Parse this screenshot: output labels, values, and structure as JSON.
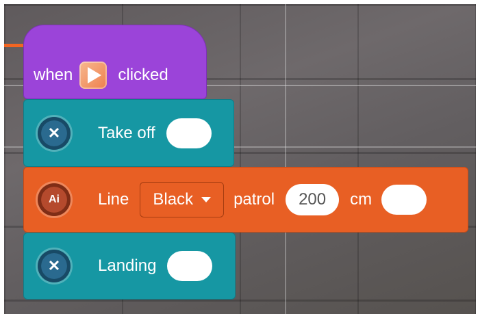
{
  "hat": {
    "prefix": "when",
    "suffix": "clicked",
    "icon": "play-icon"
  },
  "blocks": [
    {
      "label": "Take off",
      "icon": "drone-icon"
    },
    {
      "label": "Line",
      "icon": "ai-icon",
      "icon_text": "Ai",
      "dropdown": "Black",
      "action": "patrol",
      "value": "200",
      "unit": "cm"
    },
    {
      "label": "Landing",
      "icon": "drone-icon"
    }
  ],
  "colors": {
    "event": "#9b44d9",
    "drone": "#1697a3",
    "ai": "#e85f24"
  }
}
